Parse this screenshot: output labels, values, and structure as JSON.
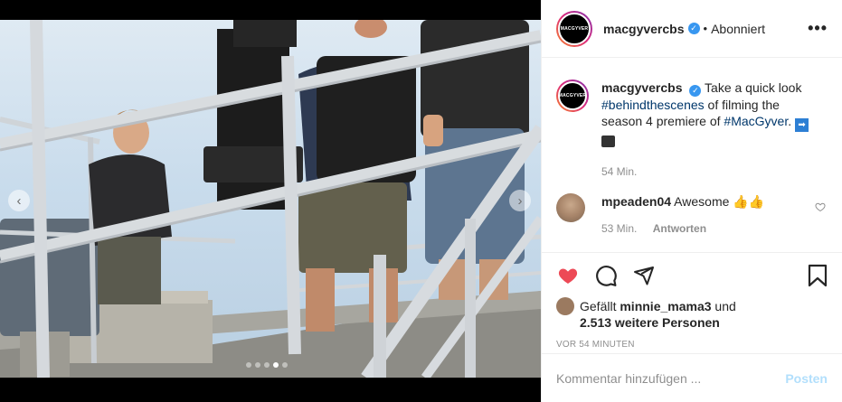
{
  "media": {
    "prev_icon": "chevron-left-icon",
    "next_icon": "chevron-right-icon",
    "prev_glyph": "‹",
    "next_glyph": "›",
    "slide_count": 5,
    "active_slide": 4
  },
  "header": {
    "avatar_text": "MACGYVER",
    "username": "macgyvercbs",
    "verified_glyph": "✓",
    "separator": "•",
    "follow_state": "Abonniert",
    "more_glyph": "•••"
  },
  "caption": {
    "avatar_text": "MACGYVER",
    "username": "macgyvercbs",
    "verified_glyph": "✓",
    "text_before": "Take a quick look",
    "hashtag1": "#behindthescenes",
    "text_middle": "of filming the season 4 premiere of",
    "hashtag2": "#MacGyver",
    "text_after": ".",
    "emoji_arrow": "➡",
    "time": "54 Min."
  },
  "comment": {
    "username": "mpeaden04",
    "text": "Awesome 👍👍",
    "time": "53 Min.",
    "reply_label": "Antworten",
    "like_icon": "heart-outline-icon"
  },
  "actions": {
    "like_icon": "heart-filled-icon",
    "comment_icon": "comment-icon",
    "share_icon": "paper-plane-icon",
    "save_icon": "bookmark-icon",
    "like_color": "#ed4956"
  },
  "likes": {
    "prefix": "Gefällt",
    "first_user": "minnie_mama3",
    "connector": "und",
    "others": "2.513 weitere Personen"
  },
  "timestamp": "VOR 54 MINUTEN",
  "comment_box": {
    "placeholder": "Kommentar hinzufügen ...",
    "post_label": "Posten"
  }
}
